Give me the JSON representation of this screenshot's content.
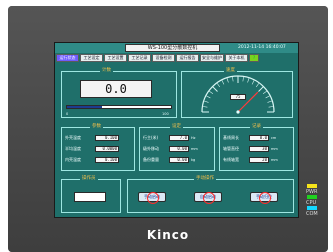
{
  "hmi": {
    "title": "WS-100型分散数控机",
    "datetime": "2012-11-14 16:40:07",
    "tabs": [
      {
        "label": "运行状态",
        "active": true
      },
      {
        "label": "工艺设定",
        "active": false
      },
      {
        "label": "工艺设置",
        "active": false
      },
      {
        "label": "工艺记录",
        "active": false
      },
      {
        "label": "设备检测",
        "active": false
      },
      {
        "label": "运行报告",
        "active": false
      },
      {
        "label": "安全与维护",
        "active": false
      },
      {
        "label": "关于本机",
        "active": false
      }
    ],
    "help_label": "?",
    "display_panel": {
      "label": "计数",
      "value": "0.0",
      "progress_fraction": 0.34,
      "scale_min": "0",
      "scale_max": "100"
    },
    "speed_panel": {
      "label": "速度",
      "gauge_min": 0,
      "gauge_max": 100,
      "gauge_value": 75,
      "gauge_readout": "75"
    },
    "params_panel": {
      "label": "参数",
      "rows": [
        {
          "label": "外壳温度",
          "value": "0.100"
        },
        {
          "label": "半均温度",
          "value": "0.0000"
        },
        {
          "label": "内壳温度",
          "value": "0.100"
        }
      ]
    },
    "settings_panel": {
      "label": "设定",
      "rows": [
        {
          "label": "行主(米)",
          "value": "7.0",
          "unit": "Hz"
        },
        {
          "label": "级外移动",
          "value": "0.00",
          "unit": "mm"
        },
        {
          "label": "备份重量",
          "value": "0.00",
          "unit": "kg"
        }
      ]
    },
    "record_panel": {
      "label": "记录",
      "rows": [
        {
          "label": "基线周长",
          "value": "0.0",
          "unit": "cm"
        },
        {
          "label": "轴管直径",
          "value": "30",
          "unit": "mm"
        },
        {
          "label": "有线轴宽",
          "value": "20",
          "unit": "mm"
        }
      ]
    },
    "operator_panel": {
      "label": "操作员",
      "input_value": ""
    },
    "manual_panel": {
      "label": "手动操作",
      "buttons": [
        {
          "label": "手动启动"
        },
        {
          "label": "自动启动"
        },
        {
          "label": "手动归位"
        }
      ]
    },
    "indicators": [
      {
        "label": "PWR",
        "color": "#f5e31a"
      },
      {
        "label": "CPU",
        "color": "#1fd11f"
      },
      {
        "label": "COM",
        "color": "#14d7ff"
      }
    ],
    "brand": "Kinco"
  }
}
